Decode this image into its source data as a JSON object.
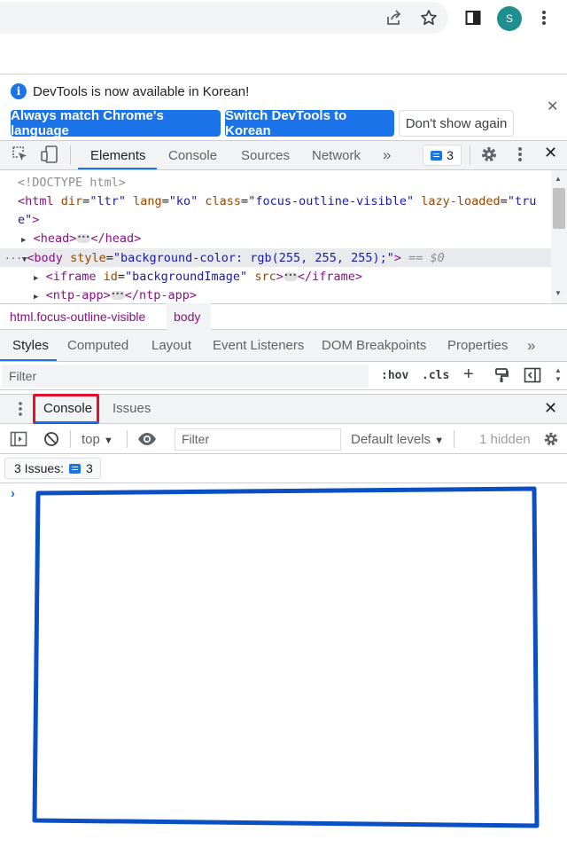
{
  "browser": {
    "profile_initial": "S"
  },
  "infobar": {
    "message": "DevTools is now available in Korean!",
    "buttons": [
      "Always match Chrome's language",
      "Switch DevTools to Korean",
      "Don't show again"
    ]
  },
  "main_tabs": {
    "items": [
      "Elements",
      "Console",
      "Sources",
      "Network"
    ],
    "active": "Elements",
    "issues_count": "3"
  },
  "dom": {
    "doctype": "<!DOCTYPE html>",
    "html_line1_tag": "<html",
    "html_attr_dir": "dir",
    "html_val_dir": "\"ltr\"",
    "html_attr_lang": "lang",
    "html_val_lang": "\"ko\"",
    "html_attr_class": "class",
    "html_val_class": "\"focus-outline-visible\"",
    "html_attr_lazy": "lazy-loaded",
    "html_val_lazy1": "\"tru",
    "html_val_lazy2": "e\"",
    "head_open": "<head>",
    "head_close": "</head>",
    "body_open": "<body",
    "body_attr_style": "style",
    "body_val_style": "\"background-color: rgb(255, 255, 255);\"",
    "body_marker": "== $0",
    "iframe_open": "<iframe",
    "iframe_attr_id": "id",
    "iframe_val_id": "\"backgroundImage\"",
    "iframe_attr_src": "src",
    "iframe_close": "</iframe>",
    "ntp_open": "<ntp-app>",
    "ntp_close": "</ntp-app>"
  },
  "breadcrumb": [
    "html.focus-outline-visible",
    "body"
  ],
  "styles_tabs": {
    "items": [
      "Styles",
      "Computed",
      "Layout",
      "Event Listeners",
      "DOM Breakpoints",
      "Properties"
    ],
    "active": "Styles"
  },
  "styles_filter": {
    "placeholder": "Filter",
    "hov": ":hov",
    "cls": ".cls"
  },
  "drawer": {
    "tabs": [
      "Console",
      "Issues"
    ],
    "active": "Console"
  },
  "console_toolbar": {
    "context": "top",
    "filter_placeholder": "Filter",
    "levels": "Default levels",
    "hidden": "1 hidden"
  },
  "issues_bar": {
    "label": "3 Issues:",
    "count": "3"
  },
  "colors": {
    "accent": "#1a73e8",
    "highlight_red": "#e0102e",
    "annotation_blue": "#0b4fc4"
  }
}
